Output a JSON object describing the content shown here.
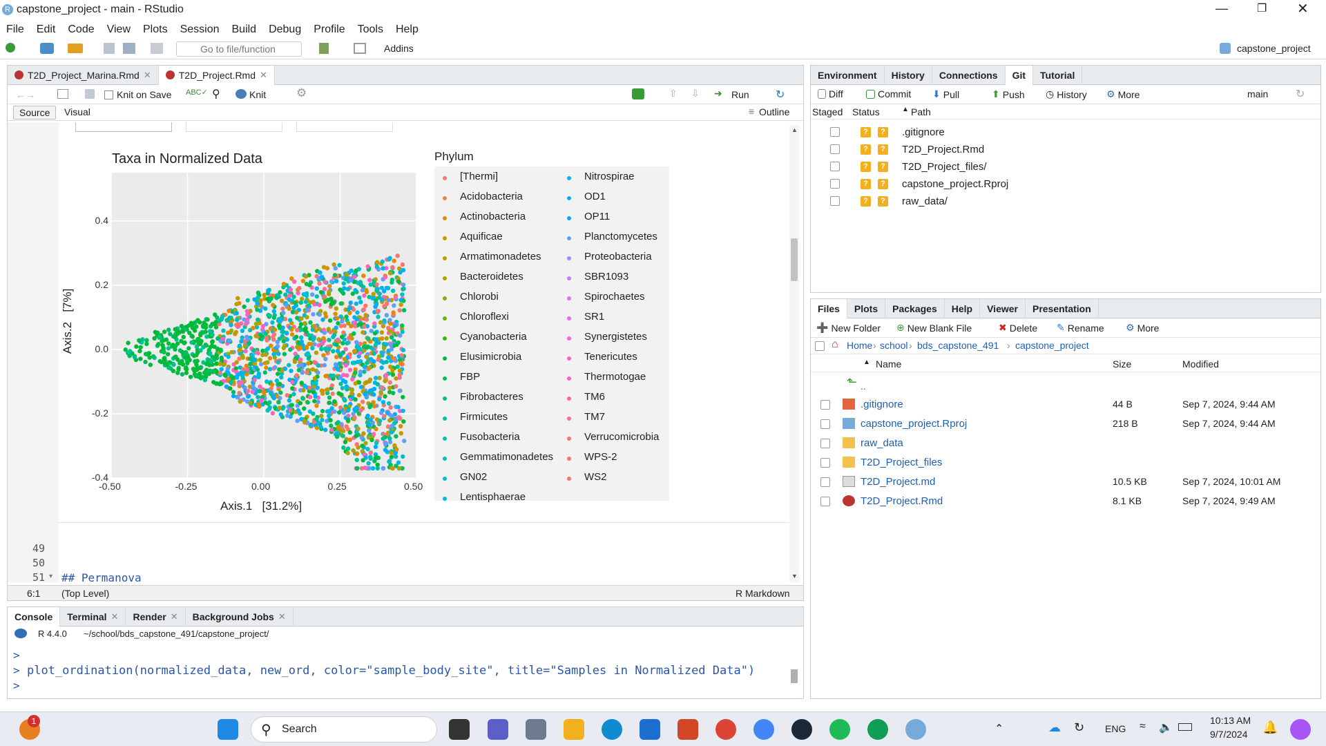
{
  "window": {
    "title": "capstone_project - main - RStudio",
    "project": "capstone_project"
  },
  "menu": [
    "File",
    "Edit",
    "Code",
    "View",
    "Plots",
    "Session",
    "Build",
    "Debug",
    "Profile",
    "Tools",
    "Help"
  ],
  "toolbar": {
    "goto_placeholder": "Go to file/function",
    "addins": "Addins"
  },
  "editor": {
    "tabs": [
      "T2D_Project_Marina.Rmd",
      "T2D_Project.Rmd"
    ],
    "knit_on_save": "Knit on Save",
    "knit": "Knit",
    "run": "Run",
    "source": "Source",
    "visual": "Visual",
    "outline": "Outline",
    "line_numbers": [
      "49",
      "50",
      "51"
    ],
    "code_line": "## Permanova",
    "status_pos": "6:1",
    "status_scope": "(Top Level)",
    "status_mode": "R Markdown"
  },
  "chart_data": {
    "type": "scatter",
    "title": "Taxa in Normalized Data",
    "xlabel": "Axis.1   [31.2%]",
    "ylabel": "Axis.2   [7%]",
    "xlim": [
      -0.5,
      0.5
    ],
    "ylim": [
      -0.4,
      0.55
    ],
    "xticks": [
      "-0.50",
      "-0.25",
      "0.00",
      "0.25",
      "0.50"
    ],
    "yticks": [
      "0.4",
      "0.2",
      "0.0",
      "-0.2",
      "-0.4"
    ],
    "legend_title": "Phylum",
    "legend_col1": [
      "[Thermi]",
      "Acidobacteria",
      "Actinobacteria",
      "Aquificae",
      "Armatimonadetes",
      "Bacteroidetes",
      "Chlorobi",
      "Chloroflexi",
      "Cyanobacteria",
      "Elusimicrobia",
      "FBP",
      "Fibrobacteres",
      "Firmicutes",
      "Fusobacteria",
      "Gemmatimonadetes",
      "GN02",
      "Lentisphaerae"
    ],
    "legend_col2": [
      "Nitrospirae",
      "OD1",
      "OP11",
      "Planctomycetes",
      "Proteobacteria",
      "SBR1093",
      "Spirochaetes",
      "SR1",
      "Synergistetes",
      "Tenericutes",
      "Thermotogae",
      "TM6",
      "TM7",
      "Verrucomicrobia",
      "WPS-2",
      "WS2"
    ],
    "colors_col1": [
      "#f8766d",
      "#ef7f49",
      "#e38900",
      "#d39200",
      "#c09b00",
      "#a9a400",
      "#8fab00",
      "#6eb100",
      "#3bb600",
      "#00ba38",
      "#00bd5f",
      "#00bf7d",
      "#00c097",
      "#00c0af",
      "#00bfc4",
      "#00bcd8",
      "#00b8e7"
    ],
    "colors_col2": [
      "#00b3f3",
      "#00adfa",
      "#00a5ff",
      "#619cff",
      "#9590ff",
      "#b983ff",
      "#d277ff",
      "#e76bf3",
      "#f564e3",
      "#fd61d1",
      "#ff62bc",
      "#ff67a4",
      "#ff6c8c",
      "#fb727a",
      "#f8766d",
      "#f8766d"
    ]
  },
  "environment_pane": {
    "tabs": [
      "Environment",
      "History",
      "Connections",
      "Git",
      "Tutorial"
    ],
    "buttons": [
      "Diff",
      "Commit",
      "Pull",
      "Push",
      "History",
      "More"
    ],
    "branch": "main",
    "headers": [
      "Staged",
      "Status",
      "Path"
    ],
    "git_files": [
      ".gitignore",
      "T2D_Project.Rmd",
      "T2D_Project_files/",
      "capstone_project.Rproj",
      "raw_data/"
    ],
    "status_mark": "?"
  },
  "files_pane": {
    "tabs": [
      "Files",
      "Plots",
      "Packages",
      "Help",
      "Viewer",
      "Presentation"
    ],
    "buttons": [
      "New Folder",
      "New Blank File",
      "Delete",
      "Rename",
      "More"
    ],
    "breadcrumb": [
      "Home",
      "school",
      "bds_capstone_491",
      "capstone_project"
    ],
    "headers": [
      "Name",
      "Size",
      "Modified"
    ],
    "up": "..",
    "files": [
      {
        "name": ".gitignore",
        "size": "44 B",
        "modified": "Sep 7, 2024, 9:44 AM"
      },
      {
        "name": "capstone_project.Rproj",
        "size": "218 B",
        "modified": "Sep 7, 2024, 9:44 AM"
      },
      {
        "name": "raw_data",
        "size": "",
        "modified": ""
      },
      {
        "name": "T2D_Project_files",
        "size": "",
        "modified": ""
      },
      {
        "name": "T2D_Project.md",
        "size": "10.5 KB",
        "modified": "Sep 7, 2024, 10:01 AM"
      },
      {
        "name": "T2D_Project.Rmd",
        "size": "8.1 KB",
        "modified": "Sep 7, 2024, 9:49 AM"
      }
    ]
  },
  "console": {
    "tabs": [
      "Console",
      "Terminal",
      "Render",
      "Background Jobs"
    ],
    "version": "R 4.4.0",
    "path": "~/school/bds_capstone_491/capstone_project/",
    "prompt": ">",
    "command": "plot_ordination(normalized_data, new_ord, color=\"sample_body_site\", title=\"Samples in Normalized Data\")"
  },
  "taskbar": {
    "search": "Search",
    "lang": "ENG",
    "time": "10:13 AM",
    "date": "9/7/2024",
    "badge": "1"
  }
}
